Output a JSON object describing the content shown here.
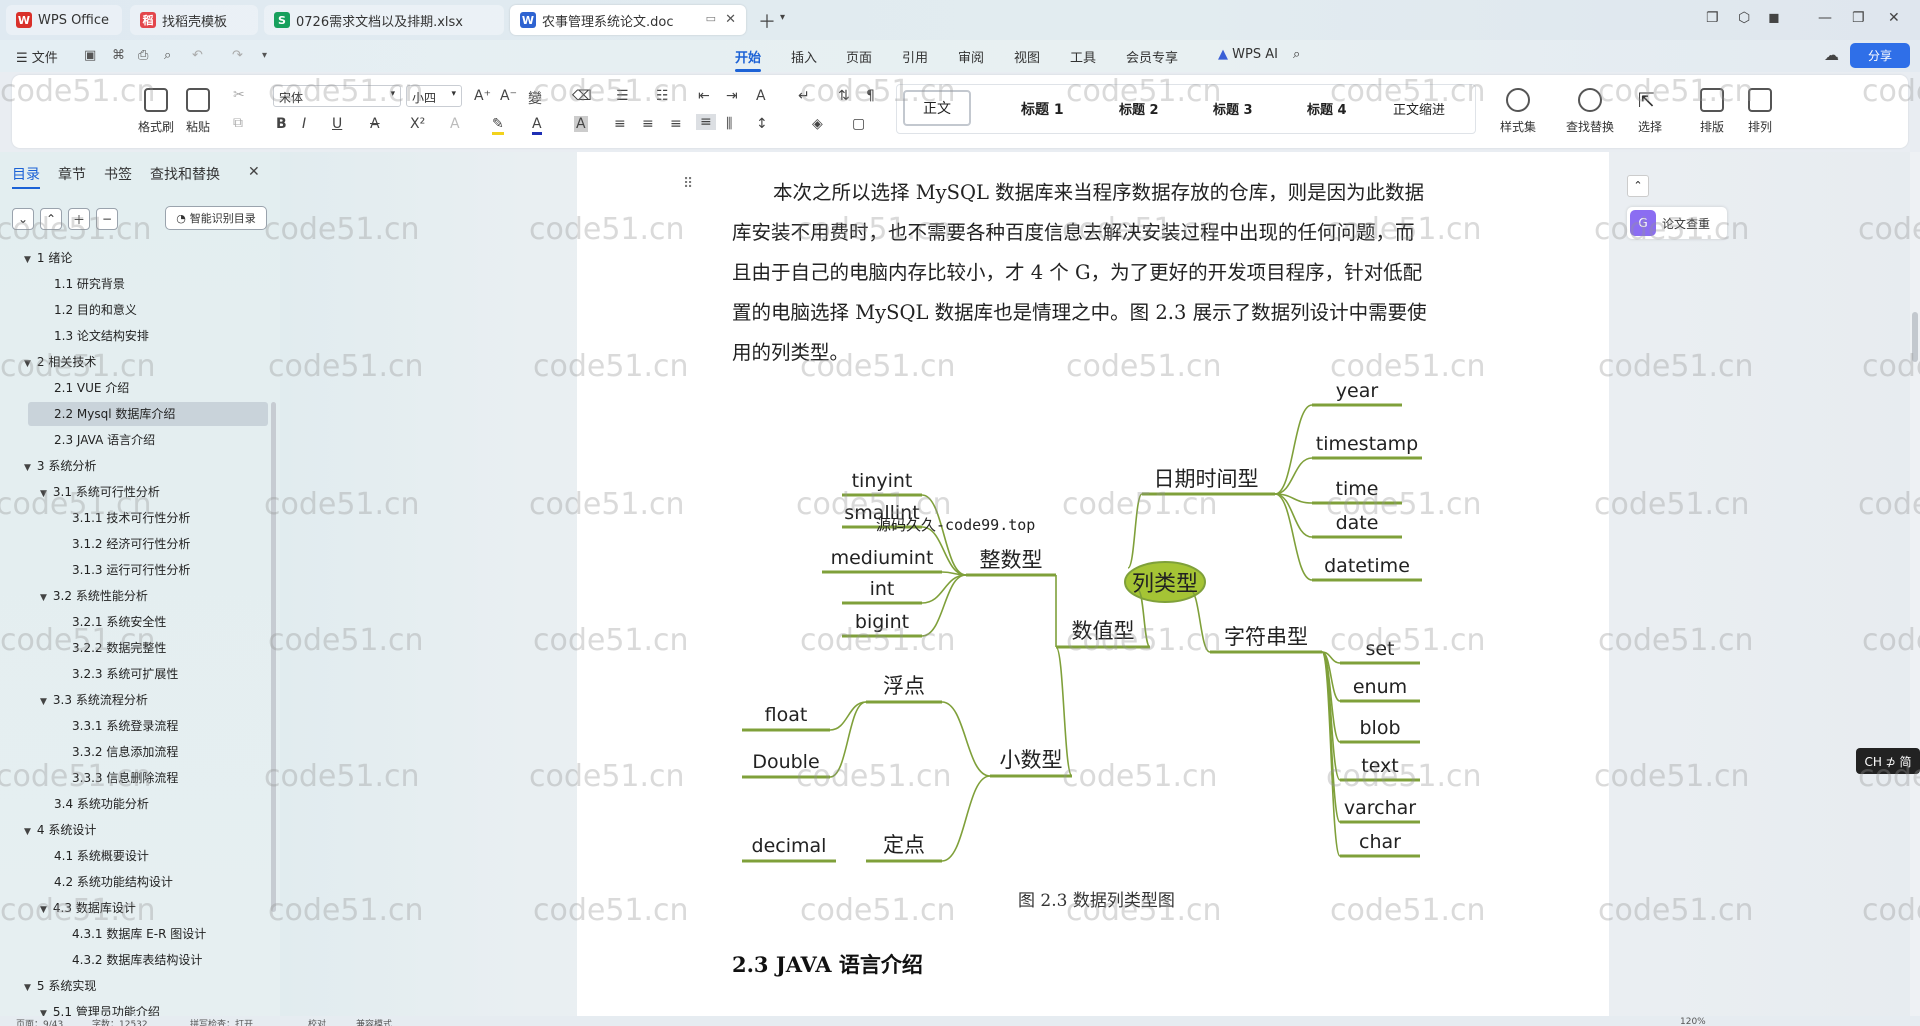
{
  "tabs": [
    {
      "label": "WPS Office",
      "color": "#d9302a",
      "icon": "wps-logo-icon"
    },
    {
      "label": "找稻壳模板",
      "color": "#e3454b",
      "icon": "docer-icon"
    },
    {
      "label": "0726需求文档以及排期.xlsx",
      "color": "#17a05d",
      "icon": "spreadsheet-icon"
    },
    {
      "label": "农事管理系统论文.doc",
      "color": "#2e63d1",
      "icon": "writer-icon"
    }
  ],
  "menu": {
    "file": "文件",
    "items": [
      "开始",
      "插入",
      "页面",
      "引用",
      "审阅",
      "视图",
      "工具",
      "会员专享"
    ],
    "wps_ai": "WPS AI",
    "share": "分享"
  },
  "ribbon": {
    "format_painter": "格式刷",
    "paste": "粘贴",
    "font_name": "宋体",
    "font_size": "小四",
    "styles": [
      "正文",
      "标题 1",
      "标题 2",
      "标题 3",
      "标题 4",
      "正文缩进"
    ],
    "style_set": "样式集",
    "find_replace": "查找替换",
    "select": "选择",
    "layout": "排版",
    "arrange": "排列"
  },
  "sidebar": {
    "tabs": [
      "目录",
      "章节",
      "书签",
      "查找和替换"
    ],
    "smart": "智能识别目录",
    "toc": [
      {
        "label": "1  绪论",
        "level": 0,
        "caret": true
      },
      {
        "label": "1.1  研究背景",
        "level": 1
      },
      {
        "label": "1.2 目的和意义",
        "level": 1
      },
      {
        "label": "1.3  论文结构安排",
        "level": 1
      },
      {
        "label": "2  相关技术",
        "level": 0,
        "caret": true
      },
      {
        "label": "2.1 VUE 介绍",
        "level": 1
      },
      {
        "label": "2.2 Mysql 数据库介绍",
        "level": 1,
        "highlight": true
      },
      {
        "label": "2.3 JAVA 语言介绍",
        "level": 1
      },
      {
        "label": "3  系统分析",
        "level": 0,
        "caret": true
      },
      {
        "label": "3.1 系统可行性分析",
        "level": 1,
        "caret": true
      },
      {
        "label": "3.1.1  技术可行性分析",
        "level": 2
      },
      {
        "label": "3.1.2  经济可行性分析",
        "level": 2
      },
      {
        "label": "3.1.3  运行可行性分析",
        "level": 2
      },
      {
        "label": "3.2 系统性能分析",
        "level": 1,
        "caret": true
      },
      {
        "label": "3.2.1  系统安全性",
        "level": 2
      },
      {
        "label": "3.2.2  数据完整性",
        "level": 2
      },
      {
        "label": "3.2.3 系统可扩展性",
        "level": 2
      },
      {
        "label": "3.3 系统流程分析",
        "level": 1,
        "caret": true
      },
      {
        "label": "3.3.1 系统登录流程",
        "level": 2
      },
      {
        "label": "3.3.2 信息添加流程",
        "level": 2
      },
      {
        "label": "3.3.3 信息删除流程",
        "level": 2
      },
      {
        "label": "3.4 系统功能分析",
        "level": 1
      },
      {
        "label": "4  系统设计",
        "level": 0,
        "caret": true
      },
      {
        "label": "4.1 系统概要设计",
        "level": 1
      },
      {
        "label": "4.2 系统功能结构设计",
        "level": 1
      },
      {
        "label": "4.3 数据库设计",
        "level": 1,
        "caret": true
      },
      {
        "label": "4.3.1 数据库 E-R 图设计",
        "level": 2
      },
      {
        "label": "4.3.2  数据库表结构设计",
        "level": 2
      },
      {
        "label": "5  系统实现",
        "level": 0,
        "caret": true
      },
      {
        "label": "5.1 管理员功能介绍",
        "level": 1,
        "caret": true
      }
    ]
  },
  "document": {
    "paragraph": [
      "本次之所以选择 MySQL 数据库来当程序数据存放的仓库，则是因为此数据",
      "库安装不用费时，也不需要各种百度信息去解决安装过程中出现的任何问题，而",
      "且由于自己的电脑内存比较小，才 4 个 G，为了更好的开发项目程序，针对低配",
      "置的电脑选择 MySQL 数据库也是情理之中。图 2.3 展示了数据列设计中需要使",
      "用的列类型。"
    ],
    "caption": "图 2.3 数据列类型图",
    "heading": "2.3 JAVA 语言介绍",
    "overlay_text": "源码久久-code99.top"
  },
  "mindmap": {
    "root": "列类型",
    "numeric": "数值型",
    "integer": "整数型",
    "integer_items": [
      "tinyint",
      "smallint",
      "mediumint",
      "int",
      "bigint"
    ],
    "decimal_type": "小数型",
    "float_group": "浮点",
    "float_items": [
      "float",
      "Double"
    ],
    "fixed_group": "定点",
    "fixed_items": [
      "decimal"
    ],
    "datetime_type": "日期时间型",
    "datetime_items": [
      "year",
      "timestamp",
      "time",
      "date",
      "datetime"
    ],
    "string_type": "字符串型",
    "string_items": [
      "set",
      "enum",
      "blob",
      "text",
      "varchar",
      "char"
    ],
    "branch_color": "#7fa03a",
    "root_color": "#a5c435"
  },
  "right_panel": {
    "plagiarism": "论文查重"
  },
  "ime": "CH ⊅ 简",
  "watermark": "code51.cn",
  "status": {
    "page": "页面：9/43",
    "words": "字数：12532",
    "spell": "拼写检查：打开",
    "proof": "校对",
    "compat": "兼容模式",
    "zoom": "120%"
  }
}
